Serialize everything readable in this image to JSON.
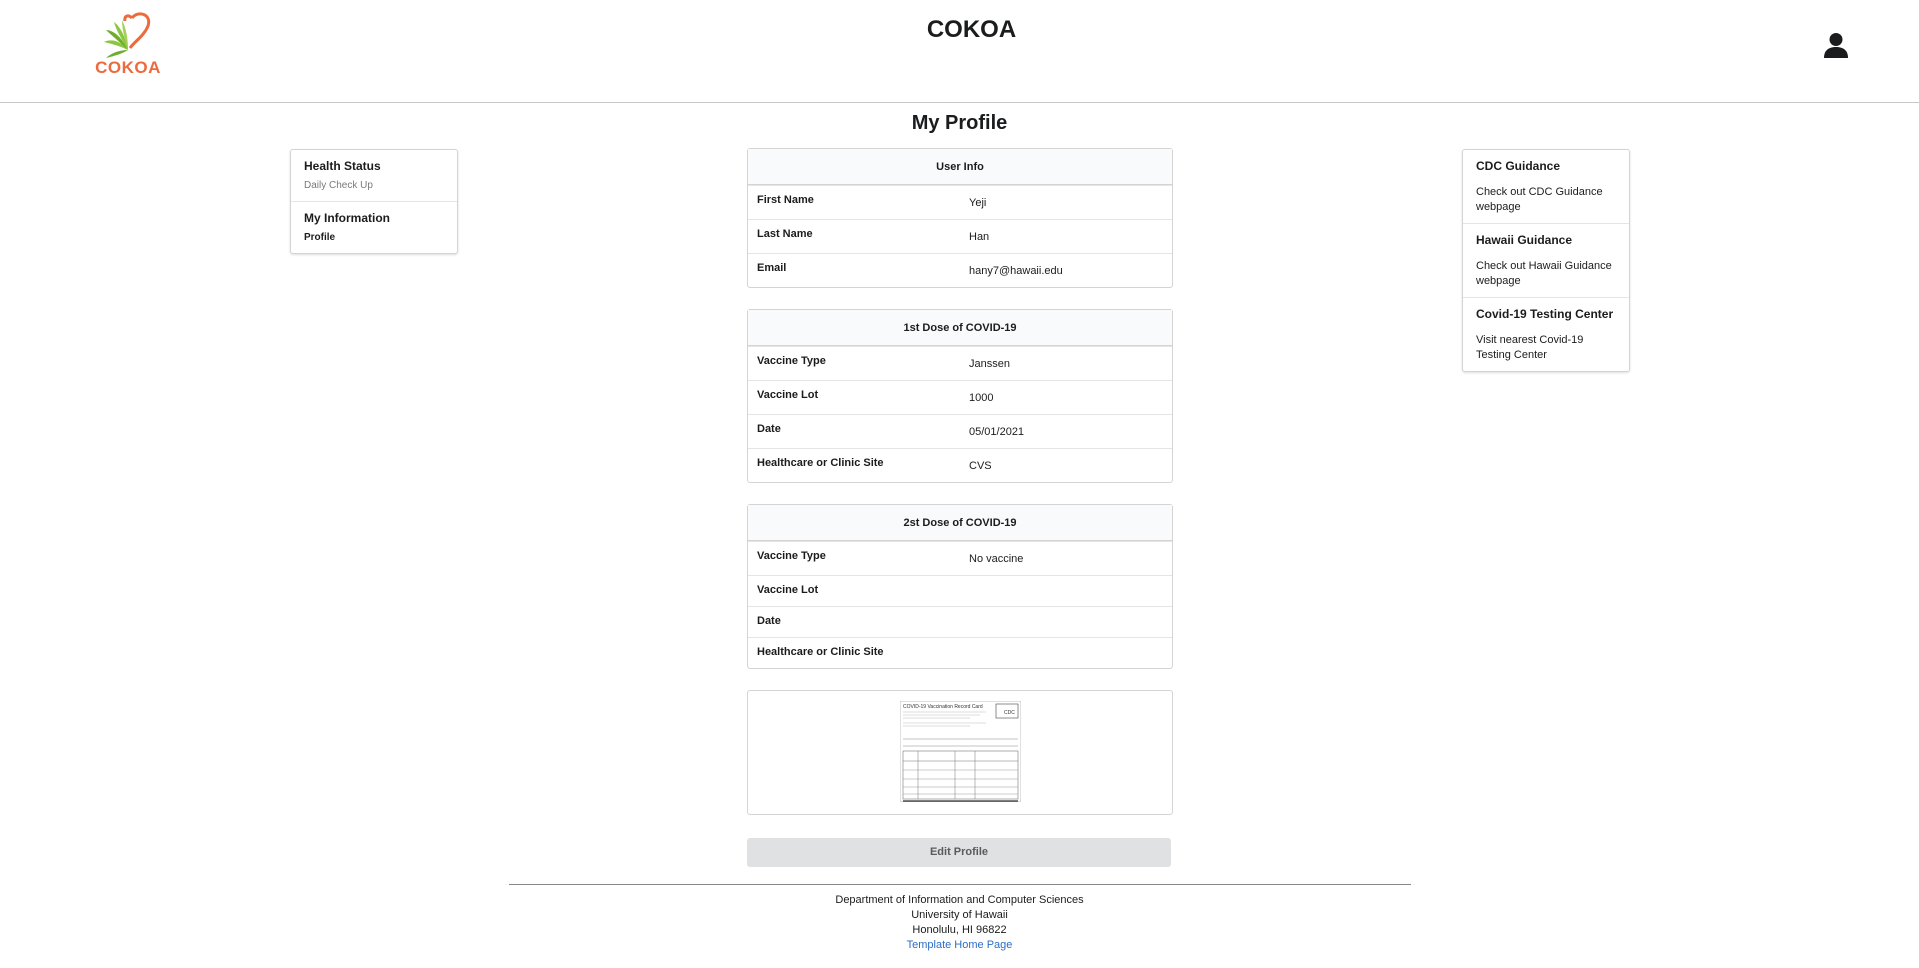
{
  "header": {
    "logo_text": "COKOA",
    "title": "COKOA",
    "user_icon": "user-icon"
  },
  "page_title": "My Profile",
  "left_menu": {
    "sections": [
      {
        "header": "Health Status",
        "items": [
          {
            "label": "Daily Check Up",
            "active": false
          }
        ]
      },
      {
        "header": "My Information",
        "items": [
          {
            "label": "Profile",
            "active": true
          }
        ]
      }
    ]
  },
  "user_info": {
    "title": "User Info",
    "rows": [
      {
        "label": "First Name",
        "value": "Yeji"
      },
      {
        "label": "Last Name",
        "value": "Han"
      },
      {
        "label": "Email",
        "value": "hany7@hawaii.edu"
      }
    ]
  },
  "dose1": {
    "title": "1st Dose of COVID-19",
    "rows": [
      {
        "label": "Vaccine Type",
        "value": "Janssen"
      },
      {
        "label": "Vaccine Lot",
        "value": "1000"
      },
      {
        "label": "Date",
        "value": "05/01/2021"
      },
      {
        "label": "Healthcare or Clinic Site",
        "value": "CVS"
      }
    ]
  },
  "dose2": {
    "title": "2st Dose of COVID-19",
    "rows": [
      {
        "label": "Vaccine Type",
        "value": "No vaccine"
      },
      {
        "label": "Vaccine Lot",
        "value": ""
      },
      {
        "label": "Date",
        "value": ""
      },
      {
        "label": "Healthcare or Clinic Site",
        "value": ""
      }
    ]
  },
  "vaccine_card_image": {
    "title": "COVID-19 Vaccination Record Card",
    "badge": "CDC"
  },
  "edit_button": "Edit Profile",
  "right_menu": {
    "sections": [
      {
        "header": "CDC Guidance",
        "link": "Check out CDC Guidance webpage"
      },
      {
        "header": "Hawaii Guidance",
        "link": "Check out Hawaii Guidance webpage"
      },
      {
        "header": "Covid-19 Testing Center",
        "link": "Visit nearest Covid-19 Testing Center"
      }
    ]
  },
  "footer": {
    "line1": "Department of Information and Computer Sciences",
    "line2": "University of Hawaii",
    "line3": "Honolulu, HI 96822",
    "link": "Template Home Page"
  },
  "colors": {
    "brand_orange": "#ec6a3c",
    "leaf_green": "#8cc63f",
    "link_blue": "#2c6ec6"
  }
}
